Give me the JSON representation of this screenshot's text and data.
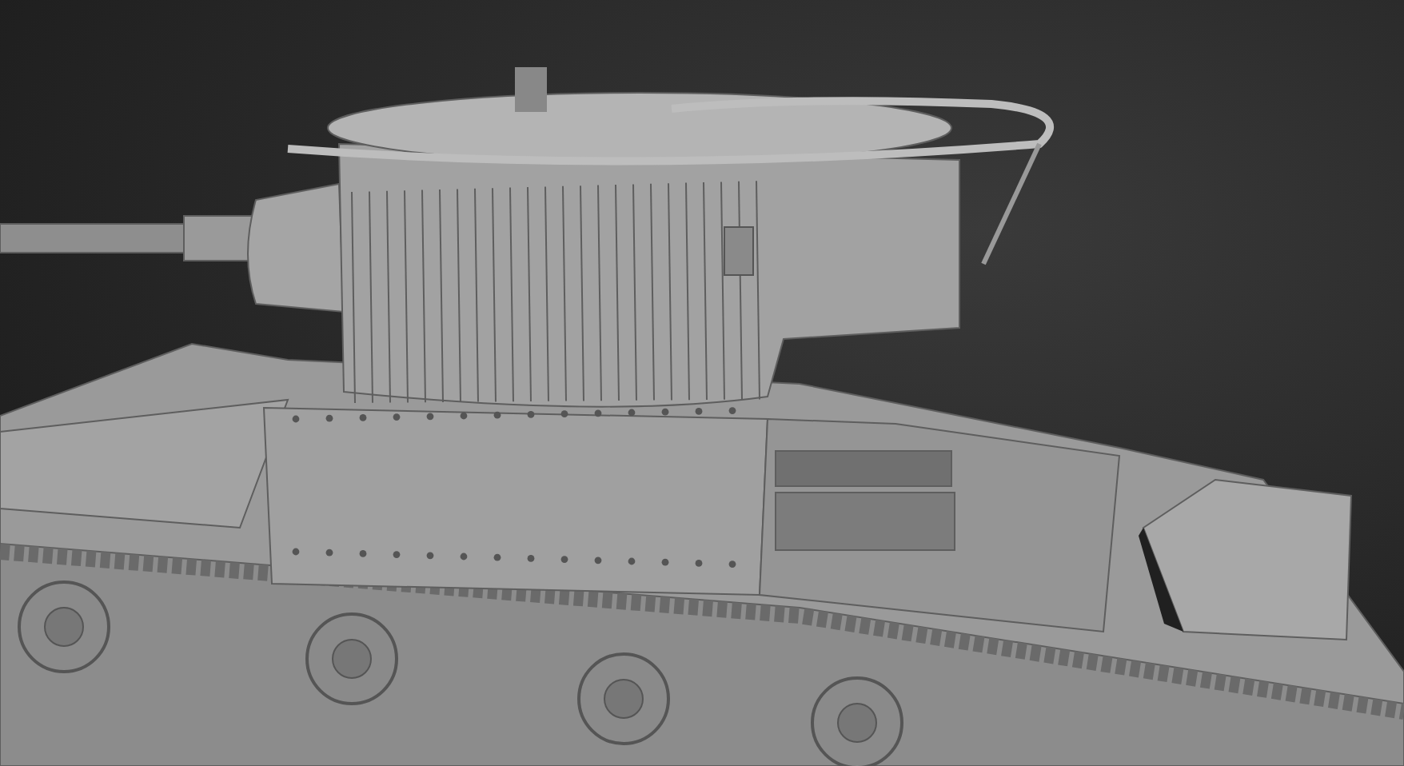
{
  "viewport": {
    "edged_faces": true
  }
}
